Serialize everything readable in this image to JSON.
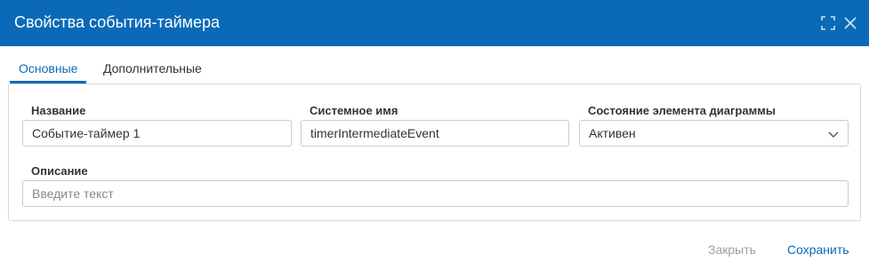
{
  "dialog": {
    "title": "Свойства события-таймера"
  },
  "tabs": [
    {
      "label": "Основные",
      "active": true
    },
    {
      "label": "Дополнительные",
      "active": false
    }
  ],
  "fields": {
    "name": {
      "label": "Название",
      "value": "Событие-таймер 1"
    },
    "system_name": {
      "label": "Системное имя",
      "value": "timerIntermediateEvent"
    },
    "state": {
      "label": "Состояние элемента диаграммы",
      "value": "Активен"
    },
    "description": {
      "label": "Описание",
      "value": "",
      "placeholder": "Введите текст"
    }
  },
  "footer": {
    "close_label": "Закрыть",
    "save_label": "Сохранить"
  },
  "colors": {
    "header": "#0a6ab8",
    "accent": "#0a6ab8",
    "disabled": "#9aa0a6"
  },
  "icons": [
    "maximize-icon",
    "close-icon",
    "chevron-down-icon"
  ]
}
